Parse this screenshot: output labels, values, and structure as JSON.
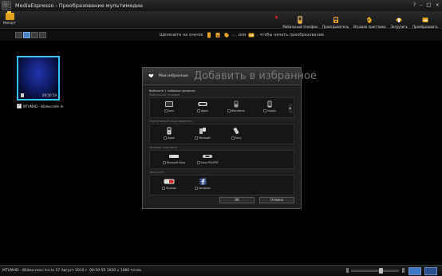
{
  "window": {
    "app_name": "MediaEspresso",
    "separator": "-",
    "subtitle": "Преобразование мультимедиа",
    "controls": [
      "?",
      "–",
      "□",
      "×"
    ]
  },
  "toolbar": {
    "import_label": "Импорт",
    "nav": [
      {
        "label": "Мобильный телефон",
        "icon": "mobile-phone-icon"
      },
      {
        "label": "Проигрыватель",
        "icon": "media-player-icon"
      },
      {
        "label": "Игровая приставка",
        "icon": "game-console-icon"
      },
      {
        "label": "Загрузить",
        "icon": "upload-icon"
      },
      {
        "label": "Преобразовать",
        "icon": "convert-icon"
      }
    ]
  },
  "hint": {
    "prefix": "Щелкните на значок",
    "ellipsis": "...",
    "middle": "или",
    "suffix": ", чтобы начать преобразование"
  },
  "media": {
    "duration": "00:50:59",
    "caption": "MTVMHD - Widescreen In"
  },
  "dialog": {
    "small_label": "Мои избранные",
    "title": "Добавить в избранное",
    "instruction": "Выберите 1 любимых профиля:",
    "groups": [
      {
        "label": "Мобильный телефон",
        "items": [
          "Acer",
          "Apple",
          "Blackberry",
          "Google"
        ]
      },
      {
        "label": "Портативный проигрыватель",
        "items": [
          "Apple",
          "Microsoft",
          "Sony"
        ]
      },
      {
        "label": "Игровая приставка",
        "items": [
          "Microsoft Xbox",
          "Sony PS3/PSP"
        ]
      },
      {
        "label": "Загрузить",
        "items": [
          "Youtube",
          "facebook"
        ]
      }
    ],
    "ok_label": "OK",
    "cancel_label": "Отмена"
  },
  "status": {
    "text": "MTVMHD - Widescreen Inn.ts  27 Август 2010 г.  00:50:59  1920 x 1080 точек"
  },
  "colors": {
    "accent_blue": "#35c6f0",
    "toolbar_orange": "#e2a21c",
    "thumb_blue": "#1a2a9a"
  }
}
